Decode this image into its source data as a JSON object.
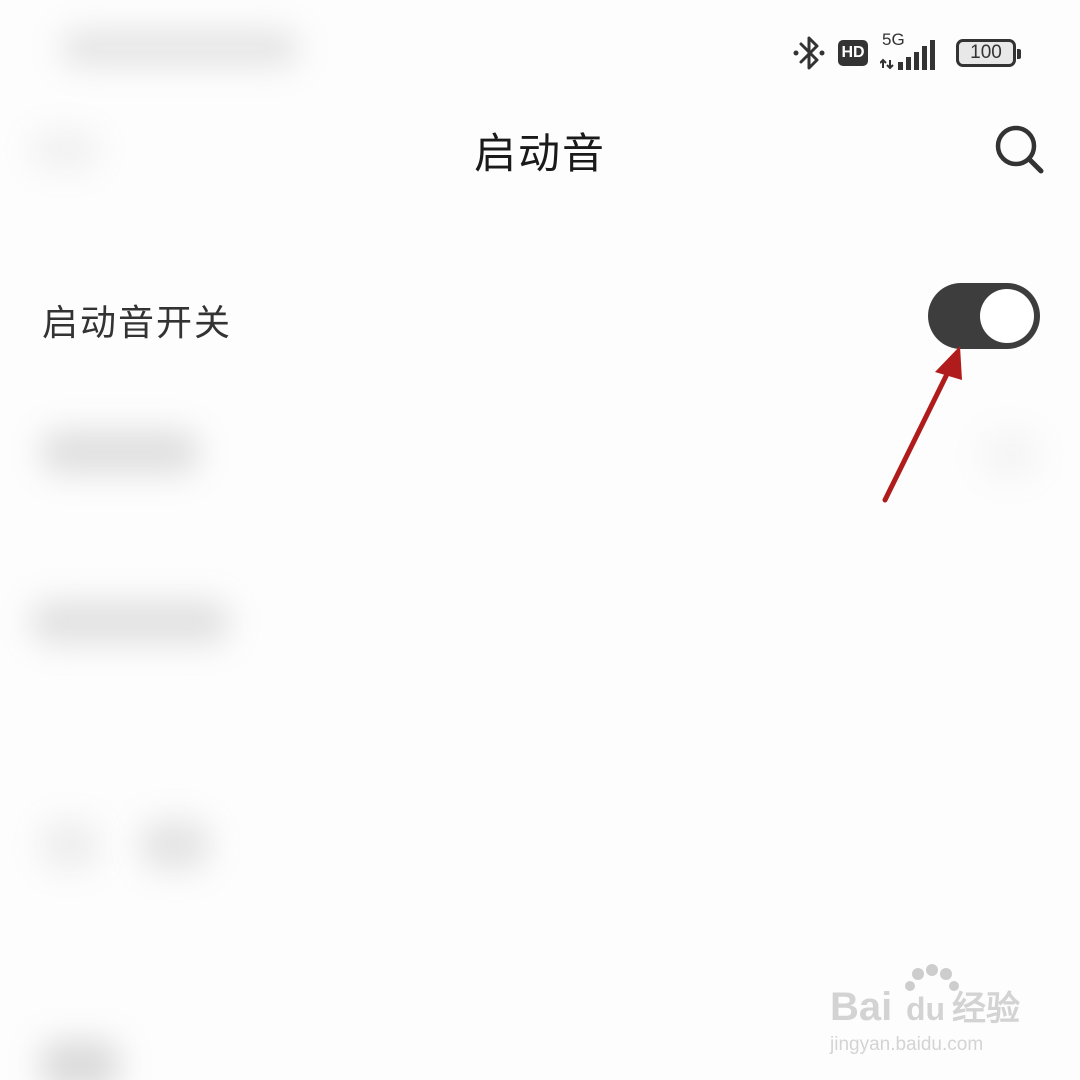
{
  "status_bar": {
    "network_label": "5G",
    "hd_label": "HD",
    "battery_level": "100",
    "signal_bars": 5
  },
  "header": {
    "title": "启动音"
  },
  "settings": {
    "boot_sound_toggle": {
      "label": "启动音开关",
      "enabled": true
    }
  },
  "watermark": {
    "brand": "Bai",
    "brand2": "du",
    "brand_cn": "经验",
    "url": "jingyan.baidu.com"
  },
  "colors": {
    "toggle_on": "#3d3d3d",
    "annotation_arrow": "#b01c1c",
    "text_primary": "#1a1a1a"
  },
  "icons": [
    "bluetooth-icon",
    "hd-icon",
    "signal-icon",
    "battery-icon",
    "search-icon"
  ]
}
